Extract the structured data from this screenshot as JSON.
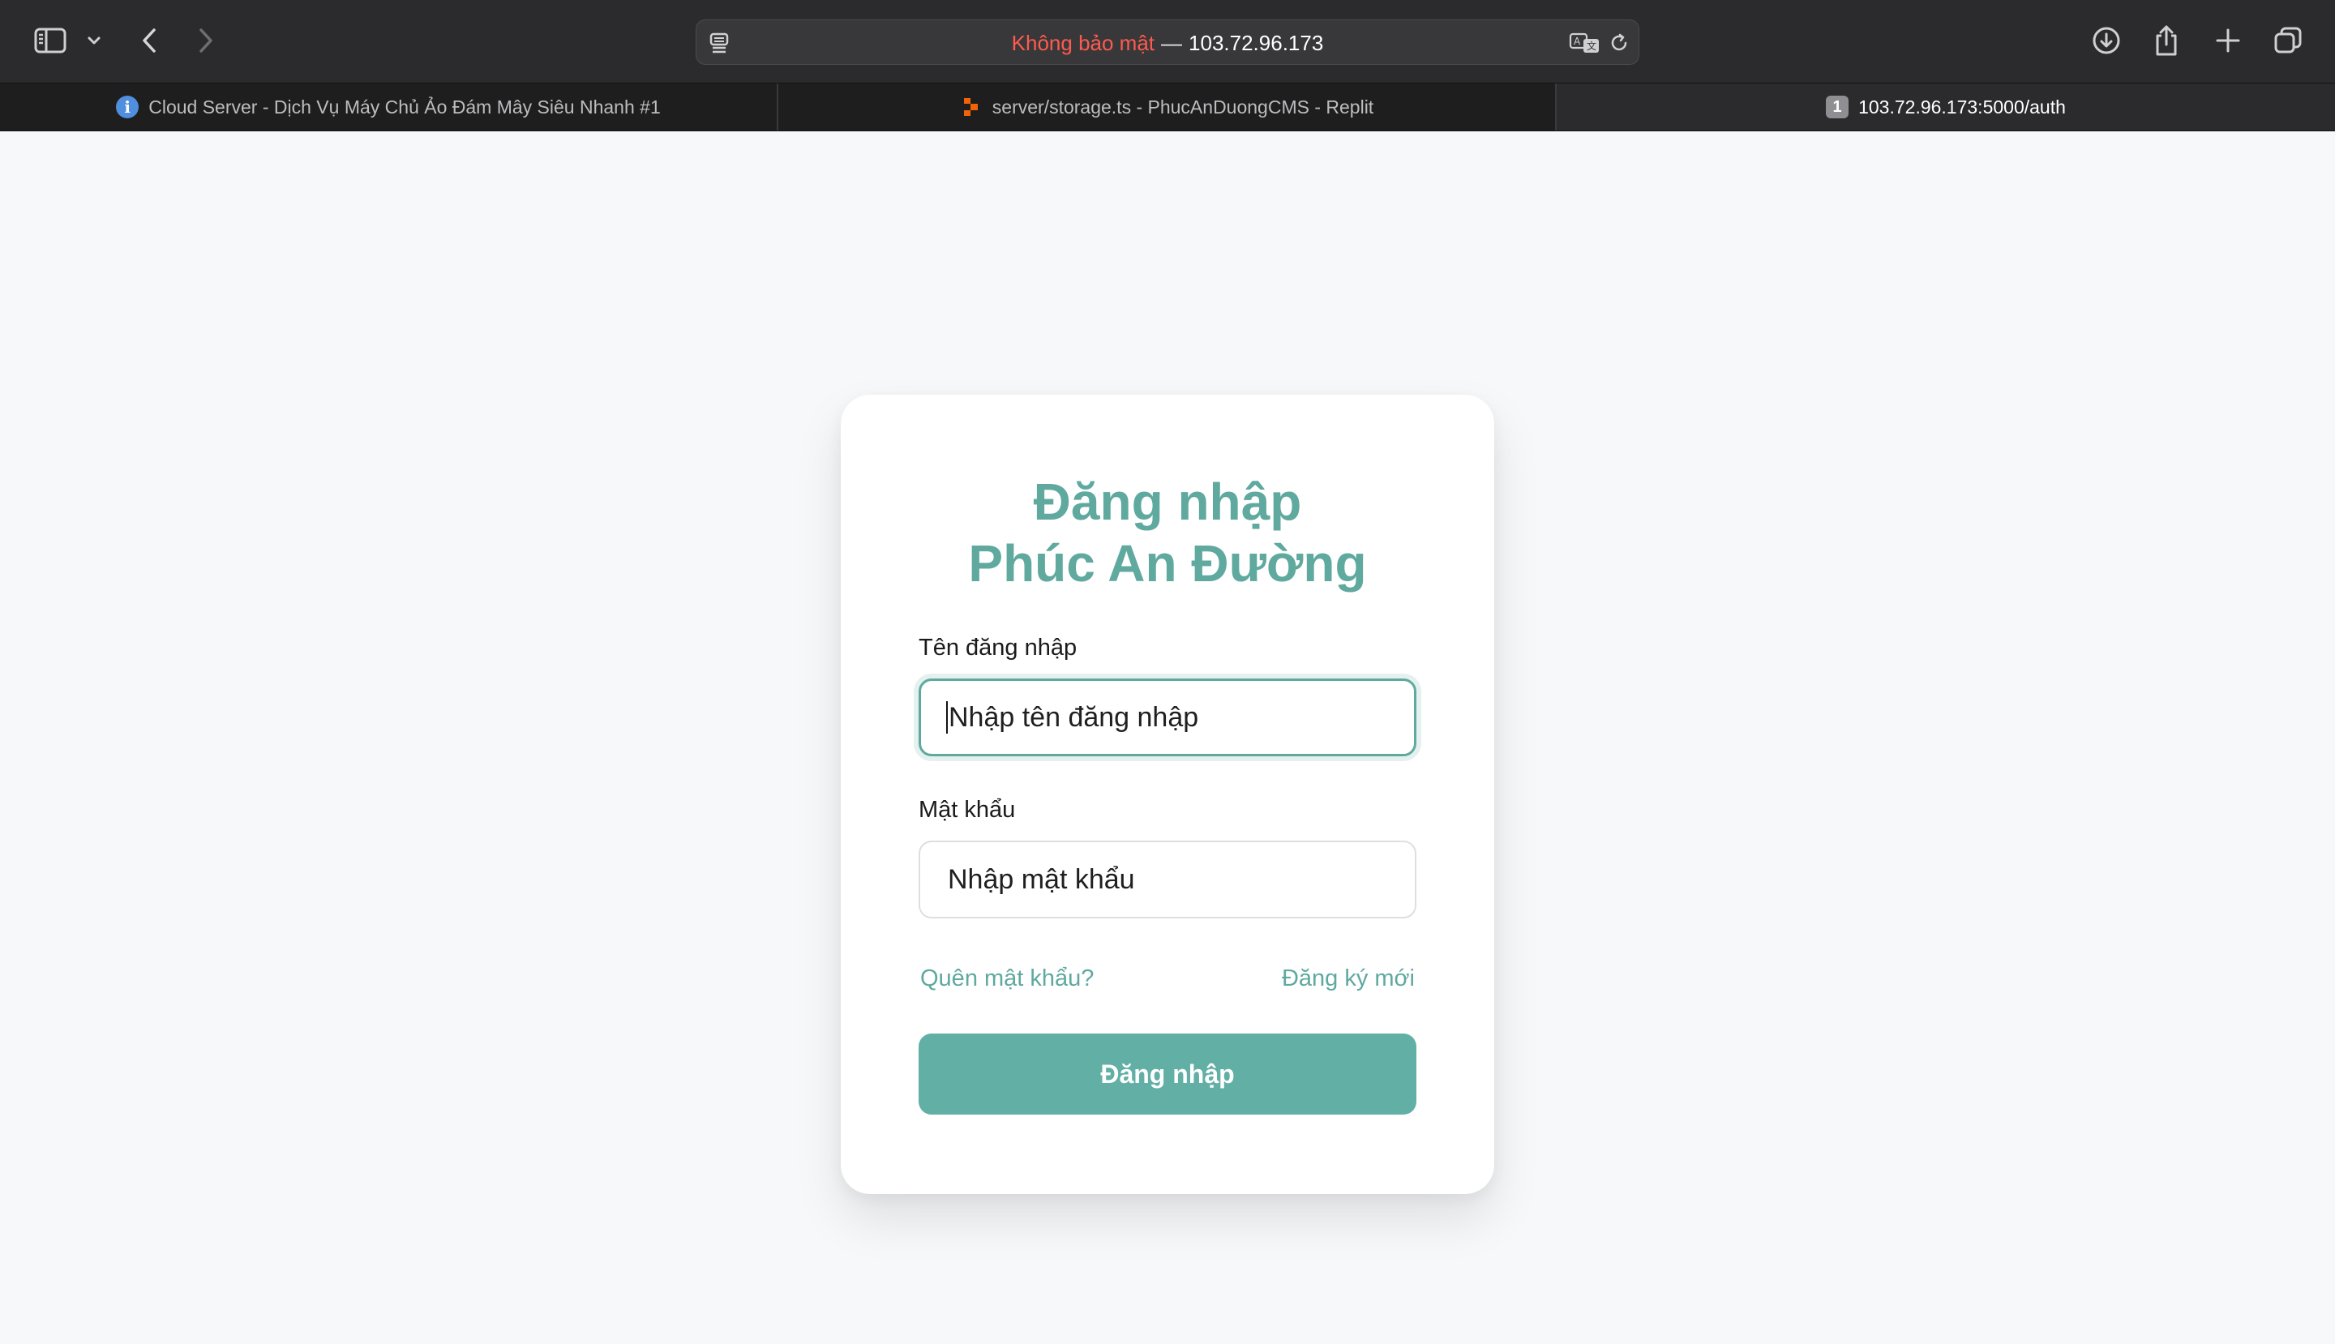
{
  "browser": {
    "address": {
      "security_label": "Không bảo mật",
      "separator": "—",
      "host": "103.72.96.173"
    },
    "tabs": [
      {
        "title": "Cloud Server - Dịch Vụ Máy Chủ Ảo Đám Mây Siêu Nhanh #1",
        "favicon": "info-icon",
        "active": false
      },
      {
        "title": "server/storage.ts - PhucAnDuongCMS - Replit",
        "favicon": "replit-icon",
        "active": false
      },
      {
        "title": "103.72.96.173:5000/auth",
        "favicon": "number-badge-icon",
        "favicon_text": "1",
        "active": true
      }
    ]
  },
  "login": {
    "title_line1": "Đăng nhập",
    "title_line2": "Phúc An Đường",
    "username": {
      "label": "Tên đăng nhập",
      "placeholder": "Nhập tên đăng nhập",
      "value": ""
    },
    "password": {
      "label": "Mật khẩu",
      "placeholder": "Nhập mật khẩu",
      "value": ""
    },
    "forgot_link": "Quên mật khẩu?",
    "register_link": "Đăng ký mới",
    "submit_label": "Đăng nhập"
  },
  "colors": {
    "accent": "#5fa99f",
    "button": "#62afa5",
    "insecure": "#ff5a4e",
    "page_bg": "#f7f8fa",
    "toolbar_bg": "#2b2b2d"
  }
}
